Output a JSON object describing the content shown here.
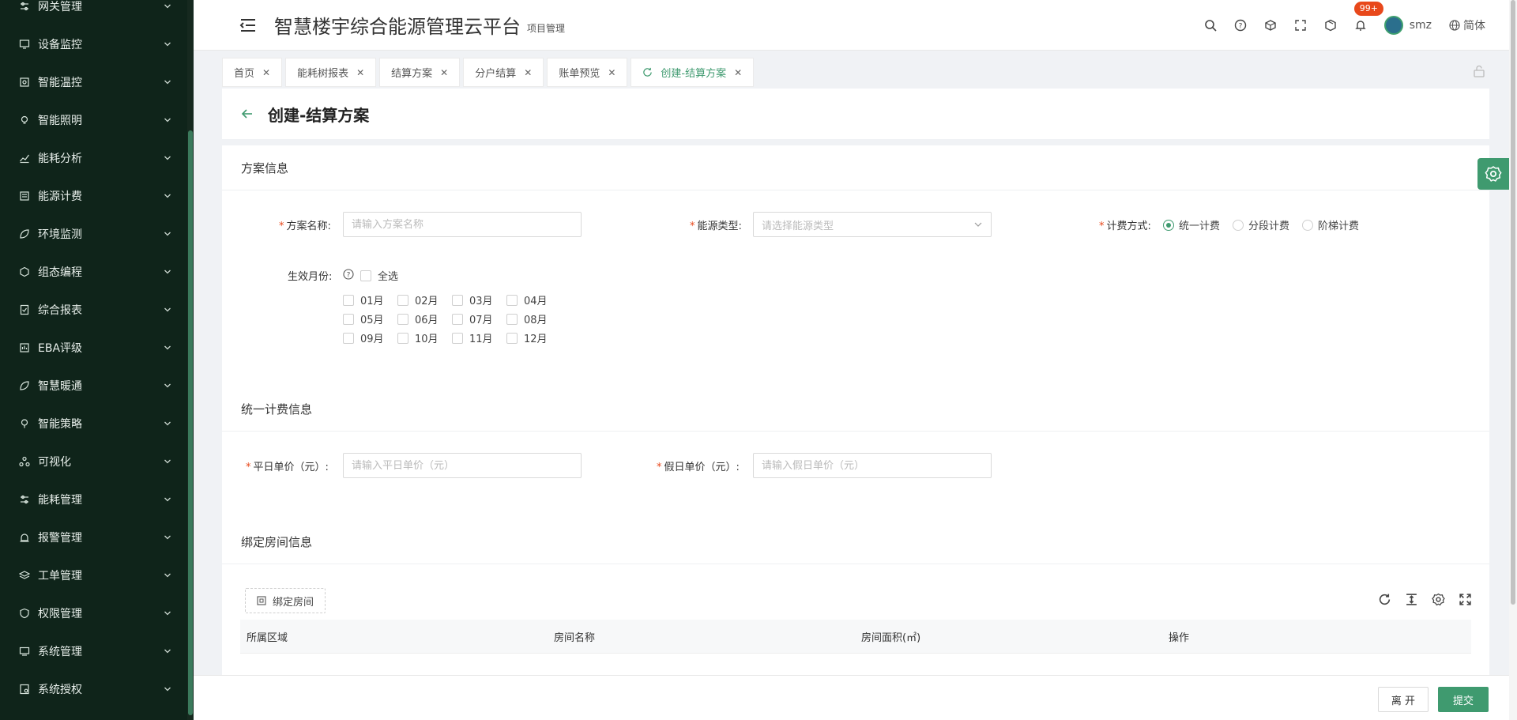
{
  "app": {
    "title": "智慧楼宇综合能源管理云平台",
    "subtitle": "项目管理"
  },
  "sidebar": {
    "items": [
      {
        "label": "网关管理",
        "icon": "sliders-icon"
      },
      {
        "label": "设备监控",
        "icon": "monitor-icon"
      },
      {
        "label": "智能温控",
        "icon": "thermostat-icon"
      },
      {
        "label": "智能照明",
        "icon": "bulb-icon"
      },
      {
        "label": "能耗分析",
        "icon": "chart-icon"
      },
      {
        "label": "能源计费",
        "icon": "billing-icon"
      },
      {
        "label": "环境监测",
        "icon": "leaf-icon"
      },
      {
        "label": "组态编程",
        "icon": "hexagon-icon"
      },
      {
        "label": "综合报表",
        "icon": "report-icon"
      },
      {
        "label": "EBA评级",
        "icon": "rating-icon"
      },
      {
        "label": "智慧暖通",
        "icon": "leaf-icon"
      },
      {
        "label": "智能策略",
        "icon": "strategy-icon"
      },
      {
        "label": "可视化",
        "icon": "visual-icon"
      },
      {
        "label": "能耗管理",
        "icon": "sliders-icon"
      },
      {
        "label": "报警管理",
        "icon": "alarm-icon"
      },
      {
        "label": "工单管理",
        "icon": "layers-icon"
      },
      {
        "label": "权限管理",
        "icon": "shield-icon"
      },
      {
        "label": "系统管理",
        "icon": "system-icon"
      },
      {
        "label": "系统授权",
        "icon": "license-icon"
      }
    ]
  },
  "header": {
    "notification_count": "99+",
    "user": "smz",
    "language": "简体"
  },
  "tabs": [
    {
      "label": "首页",
      "active": false
    },
    {
      "label": "能耗树报表",
      "active": false
    },
    {
      "label": "结算方案",
      "active": false
    },
    {
      "label": "分户结算",
      "active": false
    },
    {
      "label": "账单预览",
      "active": false
    },
    {
      "label": "创建-结算方案",
      "active": true
    }
  ],
  "page": {
    "title": "创建-结算方案"
  },
  "plan_info": {
    "section_title": "方案信息",
    "name_label": "方案名称:",
    "name_placeholder": "请输入方案名称",
    "energy_label": "能源类型:",
    "energy_placeholder": "请选择能源类型",
    "billing_label": "计费方式:",
    "billing_options": [
      "统一计费",
      "分段计费",
      "阶梯计费"
    ],
    "billing_selected": "统一计费",
    "month_label": "生效月份:",
    "select_all": "全选",
    "months": [
      "01月",
      "02月",
      "03月",
      "04月",
      "05月",
      "06月",
      "07月",
      "08月",
      "09月",
      "10月",
      "11月",
      "12月"
    ]
  },
  "unified_billing": {
    "section_title": "统一计费信息",
    "weekday_label": "平日单价（元）:",
    "weekday_placeholder": "请输入平日单价（元）",
    "holiday_label": "假日单价（元）:",
    "holiday_placeholder": "请输入假日单价（元）"
  },
  "rooms": {
    "section_title": "绑定房间信息",
    "bind_button": "绑定房间",
    "columns": [
      "所属区域",
      "房间名称",
      "房间面积(㎡)",
      "操作"
    ]
  },
  "footer": {
    "leave": "离 开",
    "submit": "提交"
  },
  "colors": {
    "accent": "#3f9a6f",
    "sidebar": "#0f241a",
    "badge": "#e8481b"
  }
}
